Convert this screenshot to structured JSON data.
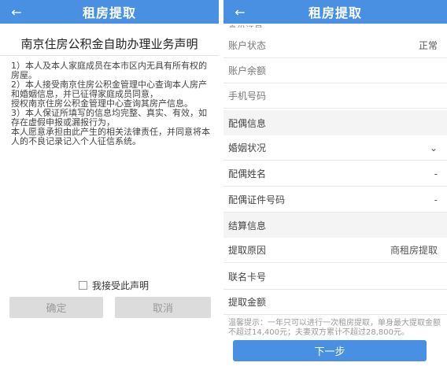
{
  "left": {
    "appbar_title": "租房提取",
    "doc_title": "南京住房公积金自助办理业务声明",
    "paragraphs": [
      "1）本人及本人家庭成员在本市区内无具有所有权的房屋。",
      "2）本人接受南京住房公积金管理中心查询本人房产和婚姻信息，并已征得家庭成员同意，",
      "授权南京住房公积金管理中心查询其房产信息。",
      "3）本人保证所填写的信息均完整、真实、有效，如存在虚假申报或漏报行为，",
      "本人愿意承担由此产生的相关法律责任，并同意将本人的不良记录记入个人征信系统。"
    ],
    "agree_label": "我接受此声明",
    "confirm_label": "确定",
    "cancel_label": "取消"
  },
  "right": {
    "appbar_title": "租房提取",
    "cut_top": "身份证号",
    "rows": [
      {
        "label": "账户状态",
        "value": "正常"
      },
      {
        "label": "账户余额",
        "value": ""
      },
      {
        "label": "手机号码",
        "value": ""
      }
    ],
    "section_spouse": "配偶信息",
    "spouse_rows": [
      {
        "label": "婚姻状况",
        "value": "⌄"
      },
      {
        "label": "配偶姓名",
        "value": "-"
      },
      {
        "label": "配偶证件号码",
        "value": "-"
      }
    ],
    "section_settle": "结算信息",
    "settle_rows": [
      {
        "label": "提取原因",
        "value": "商租房提取"
      },
      {
        "label": "联名卡号",
        "value": ""
      },
      {
        "label": "提取金额",
        "value": ""
      }
    ],
    "note": "温馨提示：一年只可以进行一次租房提取，单身最大提取金额不超过14,400元；夫妻双方累计不超过28,800元。",
    "next_label": "下一步"
  },
  "colors": {
    "accent": "#4a90e2",
    "disabled_btn": "#dcdcdc"
  }
}
